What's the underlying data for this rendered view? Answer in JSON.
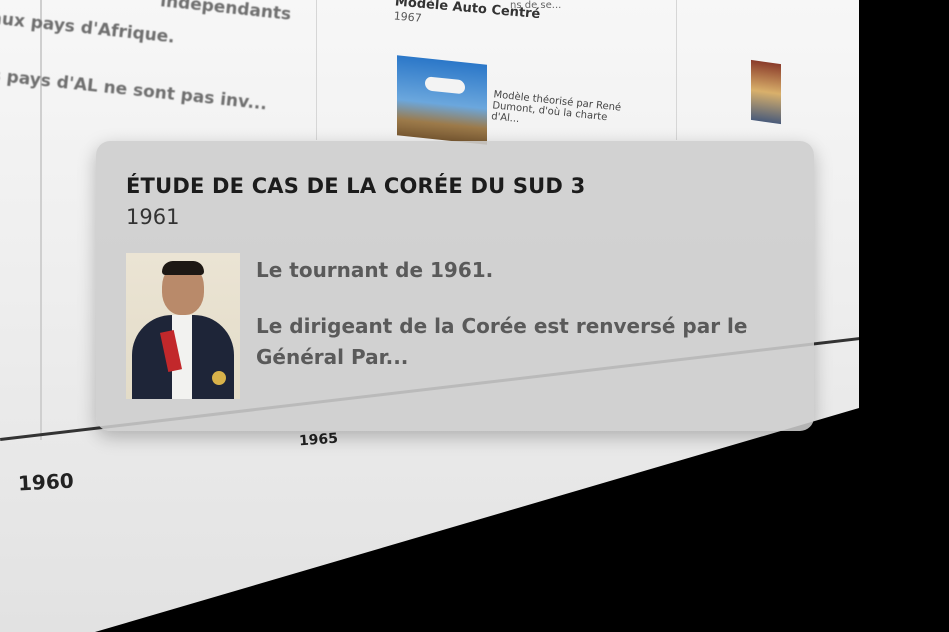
{
  "timeline": {
    "years": {
      "y1960": "1960",
      "y1965": "1965"
    },
    "background_text": {
      "line1": "aux pays d'Afrique.",
      "line1_top": "indépendants",
      "line2": "s pays d'AL ne sont pas inv..."
    },
    "bg_card": {
      "title": "Modèle Auto Centré",
      "year": "1967",
      "desc": "Modèle théorisé par René Dumont, d'où la charte d'Al...",
      "small": "ns de se..."
    }
  },
  "popup": {
    "title": "ÉTUDE DE CAS DE LA CORÉE DU SUD 3",
    "year": "1961",
    "desc_line1": "Le tournant de 1961.",
    "desc_line2": "Le dirigeant de la Corée est renversé par le Général Par..."
  },
  "colors": {
    "popup_bg": "#cdcdcd",
    "background": "#000000",
    "plane": "#efefef"
  }
}
